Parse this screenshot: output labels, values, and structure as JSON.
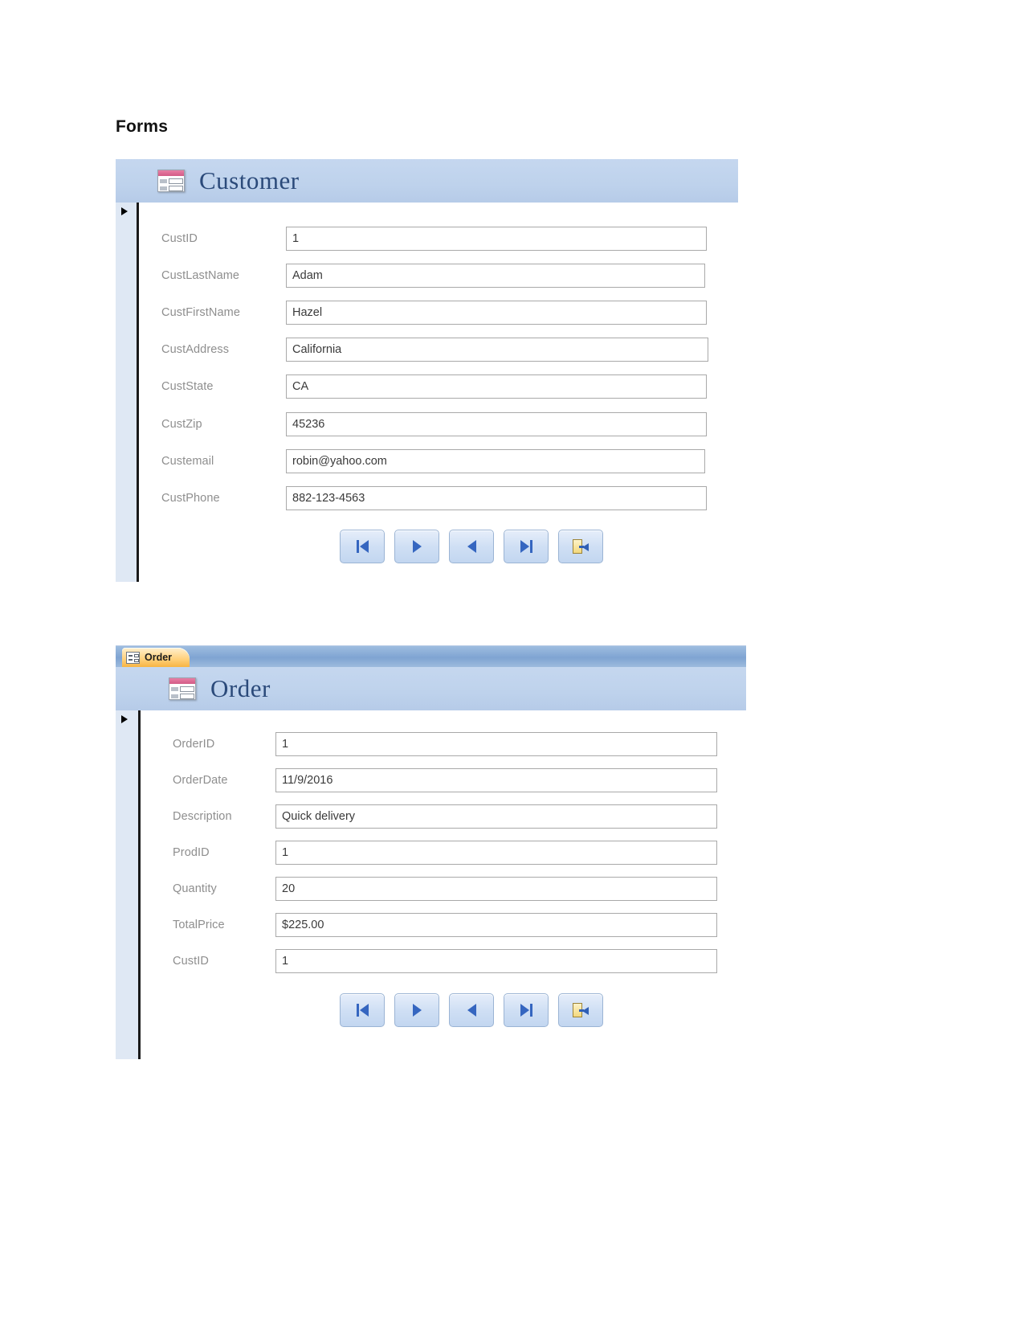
{
  "page": {
    "heading": "Forms"
  },
  "customer_form": {
    "banner_title": "Customer",
    "icon": "access-form-icon",
    "record_selector_icon": "record-selector-arrow-icon",
    "fields": [
      {
        "label": "CustID",
        "value": "1"
      },
      {
        "label": "CustLastName",
        "value": "Adam"
      },
      {
        "label": "CustFirstName",
        "value": "Hazel"
      },
      {
        "label": "CustAddress",
        "value": "California"
      },
      {
        "label": "CustState",
        "value": "CA"
      },
      {
        "label": "CustZip",
        "value": "45236"
      },
      {
        "label": "Custemail",
        "value": "robin@yahoo.com"
      },
      {
        "label": "CustPhone",
        "value": "882-123-4563"
      }
    ],
    "nav_buttons": [
      {
        "name": "first-record-button",
        "icon": "skip-to-first-icon"
      },
      {
        "name": "next-record-button",
        "icon": "play-right-icon"
      },
      {
        "name": "previous-record-button",
        "icon": "play-left-icon"
      },
      {
        "name": "last-record-button",
        "icon": "skip-to-last-icon"
      },
      {
        "name": "exit-form-button",
        "icon": "exit-door-icon"
      }
    ]
  },
  "order_form": {
    "tab_label": "Order",
    "tab_icon": "form-tab-icon",
    "banner_title": "Order",
    "icon": "access-form-icon",
    "record_selector_icon": "record-selector-arrow-icon",
    "fields": [
      {
        "label": "OrderID",
        "value": "1"
      },
      {
        "label": "OrderDate",
        "value": "11/9/2016"
      },
      {
        "label": "Description",
        "value": "Quick delivery"
      },
      {
        "label": "ProdID",
        "value": "1"
      },
      {
        "label": "Quantity",
        "value": "20"
      },
      {
        "label": "TotalPrice",
        "value": "$225.00"
      },
      {
        "label": "CustID",
        "value": "1"
      }
    ],
    "nav_buttons": [
      {
        "name": "first-record-button",
        "icon": "skip-to-first-icon"
      },
      {
        "name": "next-record-button",
        "icon": "play-right-icon"
      },
      {
        "name": "previous-record-button",
        "icon": "play-left-icon"
      },
      {
        "name": "last-record-button",
        "icon": "skip-to-last-icon"
      },
      {
        "name": "exit-form-button",
        "icon": "exit-door-icon"
      }
    ]
  },
  "colors": {
    "banner": "#bed2ec",
    "banner_title": "#2b4a7a",
    "tab_orange": "#ffd07a",
    "tabstrip_blue": "#7fa4d2",
    "label_gray": "#8e8e8e",
    "value_gray": "#3a3a3a",
    "nav_glyph_blue": "#3566c0"
  }
}
